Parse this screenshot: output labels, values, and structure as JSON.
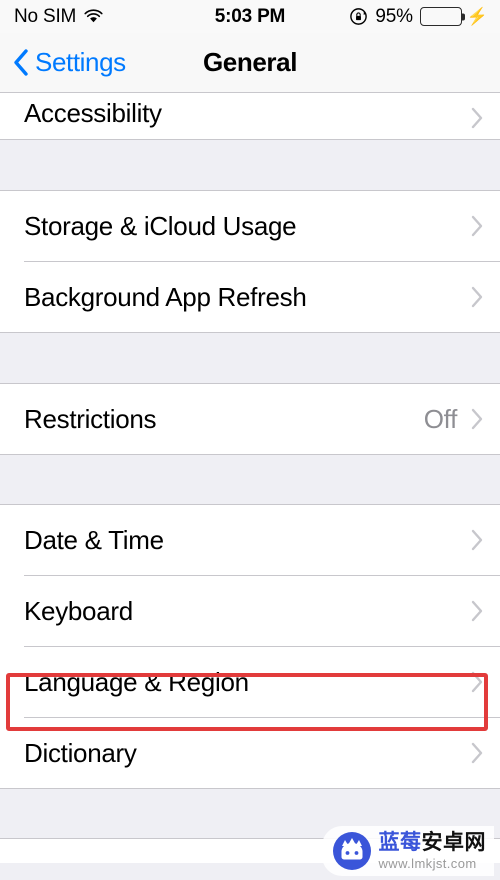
{
  "status_bar": {
    "carrier": "No SIM",
    "wifi_icon": "wifi-icon",
    "time": "5:03 PM",
    "rotation_lock_icon": "rotation-lock-icon",
    "battery_percent": "95%",
    "battery_level": 95,
    "battery_color": "#4CD964",
    "charging_icon": "charging-bolt-icon"
  },
  "nav_bar": {
    "back_icon": "back-chevron-icon",
    "back_label": "Settings",
    "title": "General",
    "accent_color": "#007AFF"
  },
  "groups": [
    {
      "id": "group-accessibility",
      "clipped_top": true,
      "rows": [
        {
          "label": "Accessibility",
          "value": "",
          "chevron": true
        }
      ]
    },
    {
      "id": "group-storage",
      "clipped_top": false,
      "rows": [
        {
          "label": "Storage & iCloud Usage",
          "value": "",
          "chevron": true
        },
        {
          "label": "Background App Refresh",
          "value": "",
          "chevron": true
        }
      ]
    },
    {
      "id": "group-restrictions",
      "clipped_top": false,
      "rows": [
        {
          "label": "Restrictions",
          "value": "Off",
          "chevron": true
        }
      ]
    },
    {
      "id": "group-localization",
      "clipped_top": false,
      "rows": [
        {
          "label": "Date & Time",
          "value": "",
          "chevron": true
        },
        {
          "label": "Keyboard",
          "value": "",
          "chevron": true
        },
        {
          "label": "Language & Region",
          "value": "",
          "chevron": true,
          "highlighted": true
        },
        {
          "label": "Dictionary",
          "value": "",
          "chevron": true
        }
      ]
    }
  ],
  "annotation": {
    "type": "highlight-rectangle",
    "target_label": "Language & Region",
    "color": "#E23B3B"
  },
  "watermark": {
    "icon": "blueberry-android-logo-icon",
    "title_blue": "蓝莓",
    "title_dark": "安卓网",
    "url": "www.lmkjst.com",
    "blue": "#3A55D9"
  }
}
